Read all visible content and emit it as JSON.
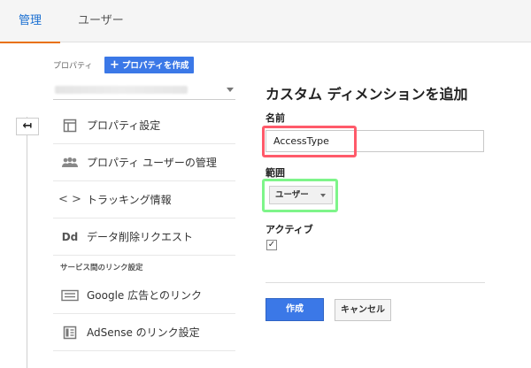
{
  "tabs": {
    "admin": "管理",
    "users": "ユーザー"
  },
  "property": {
    "label": "プロパティ",
    "create_button": "プロパティを作成"
  },
  "menu": {
    "items": [
      {
        "label": "プロパティ設定",
        "icon": "property-settings-icon"
      },
      {
        "label": "プロパティ ユーザーの管理",
        "icon": "people-icon"
      },
      {
        "label": "トラッキング情報",
        "icon": "code-icon"
      },
      {
        "label": "データ削除リクエスト",
        "icon": "dd-icon"
      }
    ],
    "section_title": "サービス間のリンク設定",
    "links": [
      {
        "label": "Google 広告とのリンク",
        "icon": "google-ads-icon"
      },
      {
        "label": "AdSense のリンク設定",
        "icon": "adsense-icon"
      }
    ]
  },
  "form": {
    "title": "カスタム ディメンションを追加",
    "name_label": "名前",
    "name_value": "AccessType",
    "scope_label": "範囲",
    "scope_value": "ユーザー",
    "active_label": "アクティブ",
    "active_checked": true,
    "create_button": "作成",
    "cancel_button": "キャンセル"
  },
  "colors": {
    "primary": "#3b78e7",
    "tab_accent": "#e8710a",
    "highlight_red": "#ff5a6a",
    "highlight_green": "#7ef58a"
  }
}
